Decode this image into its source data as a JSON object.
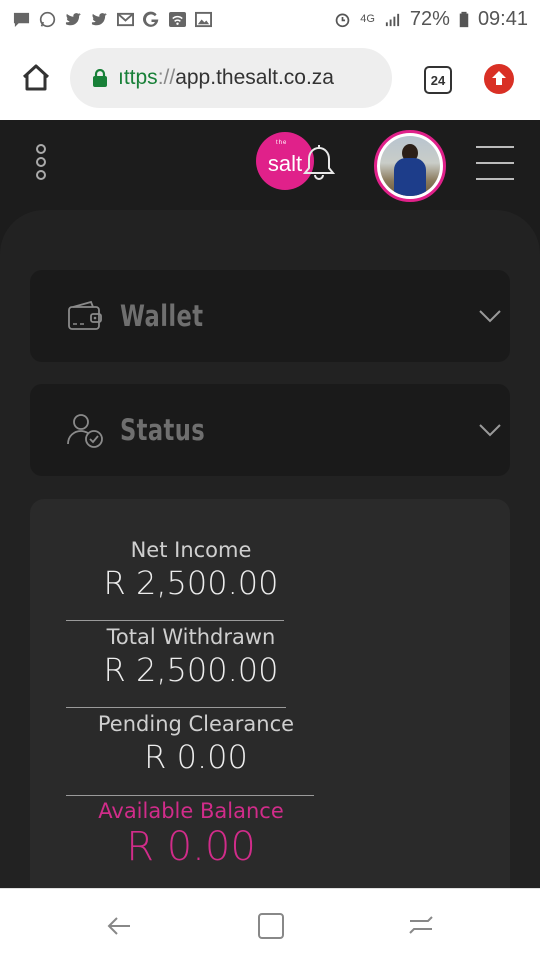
{
  "status_bar": {
    "notification_icons": [
      "message-icon",
      "whatsapp-icon",
      "twitter-icon",
      "twitter-icon",
      "gmail-icon",
      "google-icon",
      "wifi-icon",
      "image-icon"
    ],
    "network": "4G",
    "battery": "72%",
    "time": "09:41"
  },
  "browser": {
    "url_scheme": "ıttps",
    "url_sep": "://",
    "url_host": "app.thesalt.co.za",
    "tab_count": "24"
  },
  "app": {
    "logo_top": "the",
    "logo_text": "salt",
    "brand_color": "#e0218a"
  },
  "accordions": [
    {
      "label": "Wallet",
      "icon": "wallet-icon"
    },
    {
      "label": "Status",
      "icon": "user-check-icon"
    }
  ],
  "stats": {
    "net_income_label": "Net Income",
    "net_income_value": "R 2,500.00",
    "total_withdrawn_label": "Total Withdrawn",
    "total_withdrawn_value": "R 2,500.00",
    "pending_label": "Pending Clearance",
    "pending_value": "R 0.00",
    "available_label": "Available Balance",
    "available_value": "R 0.00"
  }
}
